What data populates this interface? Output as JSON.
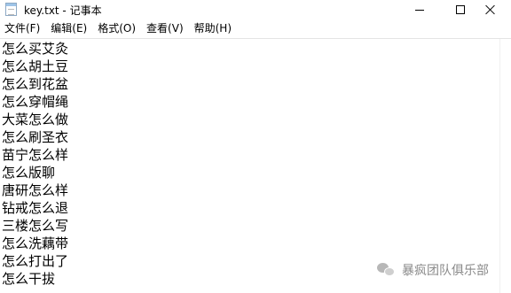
{
  "window": {
    "title": "key.txt - 记事本",
    "icon": "notepad-icon"
  },
  "controls": {
    "minimize_icon": "minimize-icon",
    "maximize_icon": "maximize-icon",
    "close_icon": "close-icon"
  },
  "menu": [
    {
      "label": "文件(F)"
    },
    {
      "label": "编辑(E)"
    },
    {
      "label": "格式(O)"
    },
    {
      "label": "查看(V)"
    },
    {
      "label": "帮助(H)"
    }
  ],
  "document": {
    "lines": [
      "怎么买艾灸",
      "怎么胡土豆",
      "怎么到花盆",
      "怎么穿帽绳",
      "大菜怎么做",
      "怎么刷圣衣",
      "苗宁怎么样",
      "怎么版聊",
      "唐研怎么样",
      "钻戒怎么退",
      "三楼怎么写",
      "怎么洗藕带",
      "怎么打出了",
      "怎么干拔"
    ]
  },
  "watermark": {
    "icon": "wechat-icon",
    "text": "暴疯团队俱乐部"
  }
}
